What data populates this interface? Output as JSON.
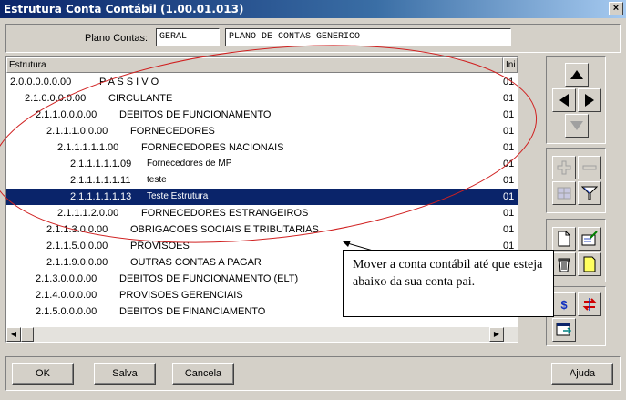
{
  "window": {
    "title": "Estrutura Conta Contábil (1.00.01.013)",
    "close_glyph": "×"
  },
  "plano": {
    "label": "Plano Contas:",
    "code": "GERAL",
    "name": "PLANO DE CONTAS GENERICO"
  },
  "tree": {
    "headers": [
      "Estrutura",
      "Ini"
    ],
    "rows": [
      {
        "code": "2.0.0.0.0.0.00",
        "desc": "P A S S I V O",
        "ini": "01",
        "level": 0
      },
      {
        "code": "2.1.0.0.0.0.00",
        "desc": "CIRCULANTE",
        "ini": "01",
        "level": 1
      },
      {
        "code": "2.1.1.0.0.0.00",
        "desc": "DEBITOS DE FUNCIONAMENTO",
        "ini": "01",
        "level": 2
      },
      {
        "code": "2.1.1.1.0.0.00",
        "desc": "FORNECEDORES",
        "ini": "01",
        "level": 3
      },
      {
        "code": "2.1.1.1.1.1.00",
        "desc": "FORNECEDORES NACIONAIS",
        "ini": "01",
        "level": 4
      },
      {
        "code": "2.1.1.1.1.1.09",
        "desc": "Fornecedores de MP",
        "ini": "01",
        "level": 5
      },
      {
        "code": "2.1.1.1.1.1.11",
        "desc": "teste",
        "ini": "01",
        "level": 5
      },
      {
        "code": "2.1.1.1.1.1.13",
        "desc": "Teste Estrutura",
        "ini": "01",
        "level": 5,
        "selected": true
      },
      {
        "code": "2.1.1.1.2.0.00",
        "desc": "FORNECEDORES ESTRANGEIROS",
        "ini": "01",
        "level": 4
      },
      {
        "code": "2.1.1.3.0.0.00",
        "desc": "OBRIGACOES SOCIAIS E TRIBUTARIAS",
        "ini": "01",
        "level": 3
      },
      {
        "code": "2.1.1.5.0.0.00",
        "desc": "PROVISOES",
        "ini": "01",
        "level": 3
      },
      {
        "code": "2.1.1.9.0.0.00",
        "desc": "OUTRAS CONTAS A PAGAR",
        "ini": "",
        "level": 3
      },
      {
        "code": "2.1.3.0.0.0.00",
        "desc": "DEBITOS DE FUNCIONAMENTO (ELT)",
        "ini": "",
        "level": 2
      },
      {
        "code": "2.1.4.0.0.0.00",
        "desc": "PROVISOES GERENCIAIS",
        "ini": "",
        "level": 2
      },
      {
        "code": "2.1.5.0.0.0.00",
        "desc": "DEBITOS DE FINANCIAMENTO",
        "ini": "",
        "level": 2
      }
    ]
  },
  "callout": {
    "text": "Mover a conta contábil até que esteja abaixo da sua conta pai."
  },
  "buttons": {
    "ok": "OK",
    "salva": "Salva",
    "cancela": "Cancela",
    "ajuda": "Ajuda"
  },
  "icons": {
    "dollar": "$"
  },
  "colors": {
    "selection": "#0a246a",
    "annotation_red": "#d02020"
  }
}
